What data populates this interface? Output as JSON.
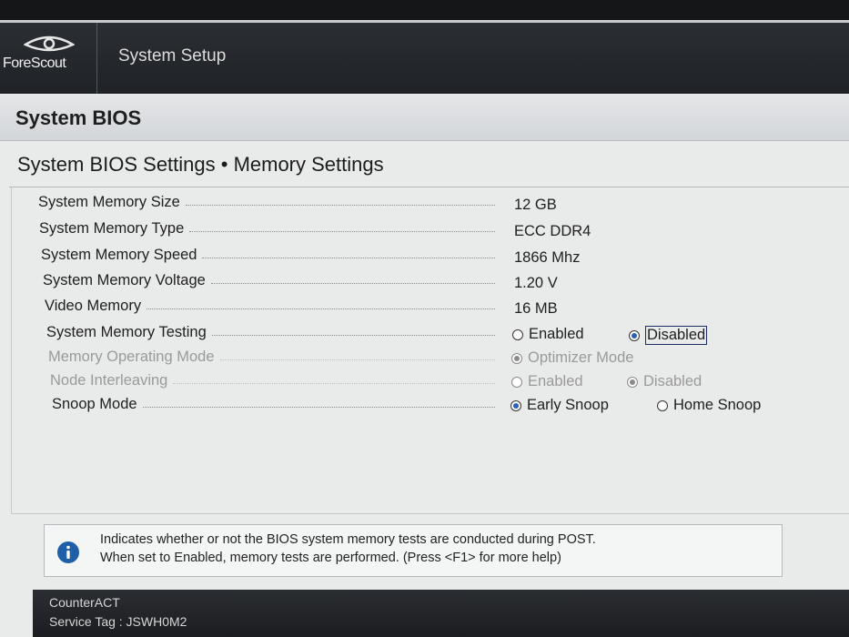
{
  "header": {
    "logo_text": "ForeScout",
    "app_title": "System Setup"
  },
  "section": {
    "title": "System BIOS"
  },
  "page": {
    "heading": "System BIOS Settings • Memory Settings"
  },
  "settings": [
    {
      "label": "System Memory Size",
      "value": "12 GB"
    },
    {
      "label": "System Memory Type",
      "value": "ECC DDR4"
    },
    {
      "label": "System Memory Speed",
      "value": "1866 Mhz"
    },
    {
      "label": "System Memory Voltage",
      "value": "1.20 V"
    },
    {
      "label": "Video Memory",
      "value": "16 MB"
    },
    {
      "label": "System Memory Testing",
      "options": [
        "Enabled",
        "Disabled"
      ],
      "selected": "Disabled"
    },
    {
      "label": "Memory Operating Mode",
      "options": [
        "Optimizer Mode"
      ],
      "selected": "Optimizer Mode",
      "disabled": true
    },
    {
      "label": "Node Interleaving",
      "options": [
        "Enabled",
        "Disabled"
      ],
      "selected": "Disabled",
      "disabled": true
    },
    {
      "label": "Snoop Mode",
      "options": [
        "Early Snoop",
        "Home Snoop"
      ],
      "selected": "Early Snoop"
    }
  ],
  "help": {
    "line1": "Indicates whether or not the BIOS system memory tests are conducted during POST.",
    "line2": "When set to Enabled, memory tests are performed. (Press <F1> for more help)"
  },
  "footer": {
    "line1": "CounterACT",
    "line2": "Service Tag : JSWH0M2"
  },
  "colors": {
    "header_bg": "#23262a",
    "radio_selected": "#2b5fb5",
    "info_icon": "#1f5fa8"
  }
}
